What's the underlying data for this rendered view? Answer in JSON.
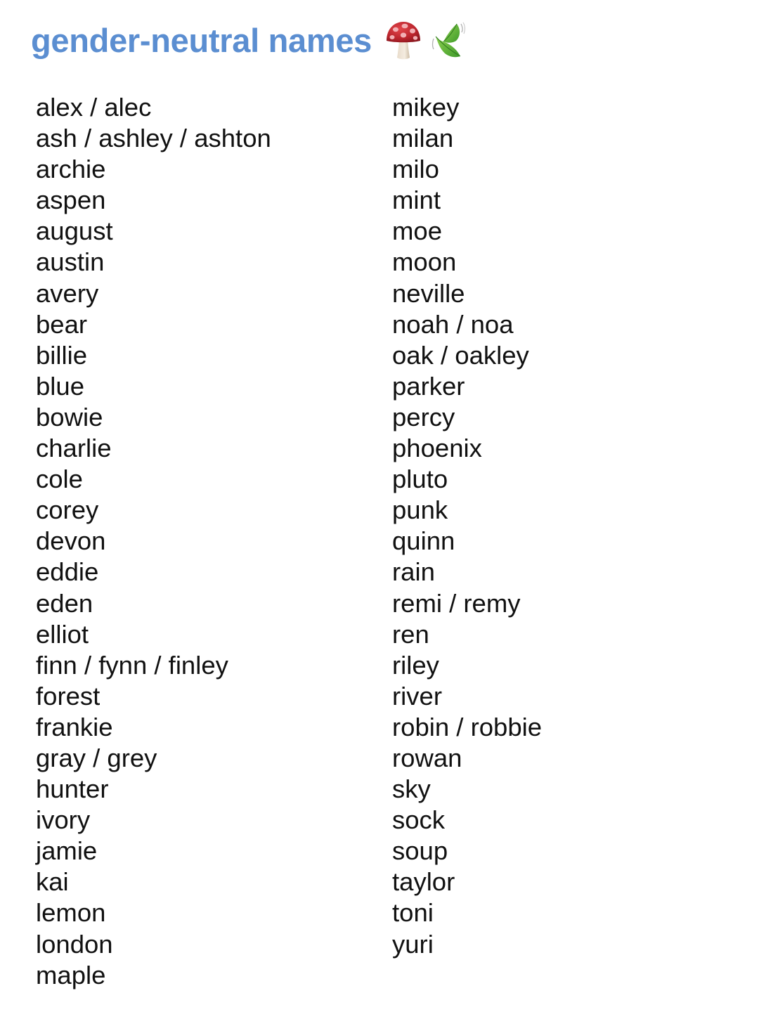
{
  "header": {
    "title": "gender-neutral names",
    "icons": [
      "mushroom-icon",
      "leaf-fluttering-icon"
    ],
    "title_color": "#5b8ed1"
  },
  "columns": {
    "left": [
      "alex / alec",
      "ash / ashley / ashton",
      "archie",
      "aspen",
      "august",
      "austin",
      "avery",
      "bear",
      "billie",
      "blue",
      "bowie",
      "charlie",
      "cole",
      "corey",
      "devon",
      "eddie",
      "eden",
      "elliot",
      "finn / fynn / finley",
      "forest",
      "frankie",
      "gray / grey",
      "hunter",
      "ivory",
      "jamie",
      "kai",
      "lemon",
      "london",
      "maple"
    ],
    "right": [
      "mikey",
      "milan",
      "milo",
      "mint",
      "moe",
      "moon",
      "neville",
      "noah / noa",
      "oak / oakley",
      "parker",
      "percy",
      "phoenix",
      "pluto",
      "punk",
      "quinn",
      "rain",
      "remi / remy",
      "ren",
      "riley",
      "river",
      "robin / robbie",
      "rowan",
      "sky",
      "sock",
      "soup",
      "taylor",
      "toni",
      "yuri"
    ]
  }
}
